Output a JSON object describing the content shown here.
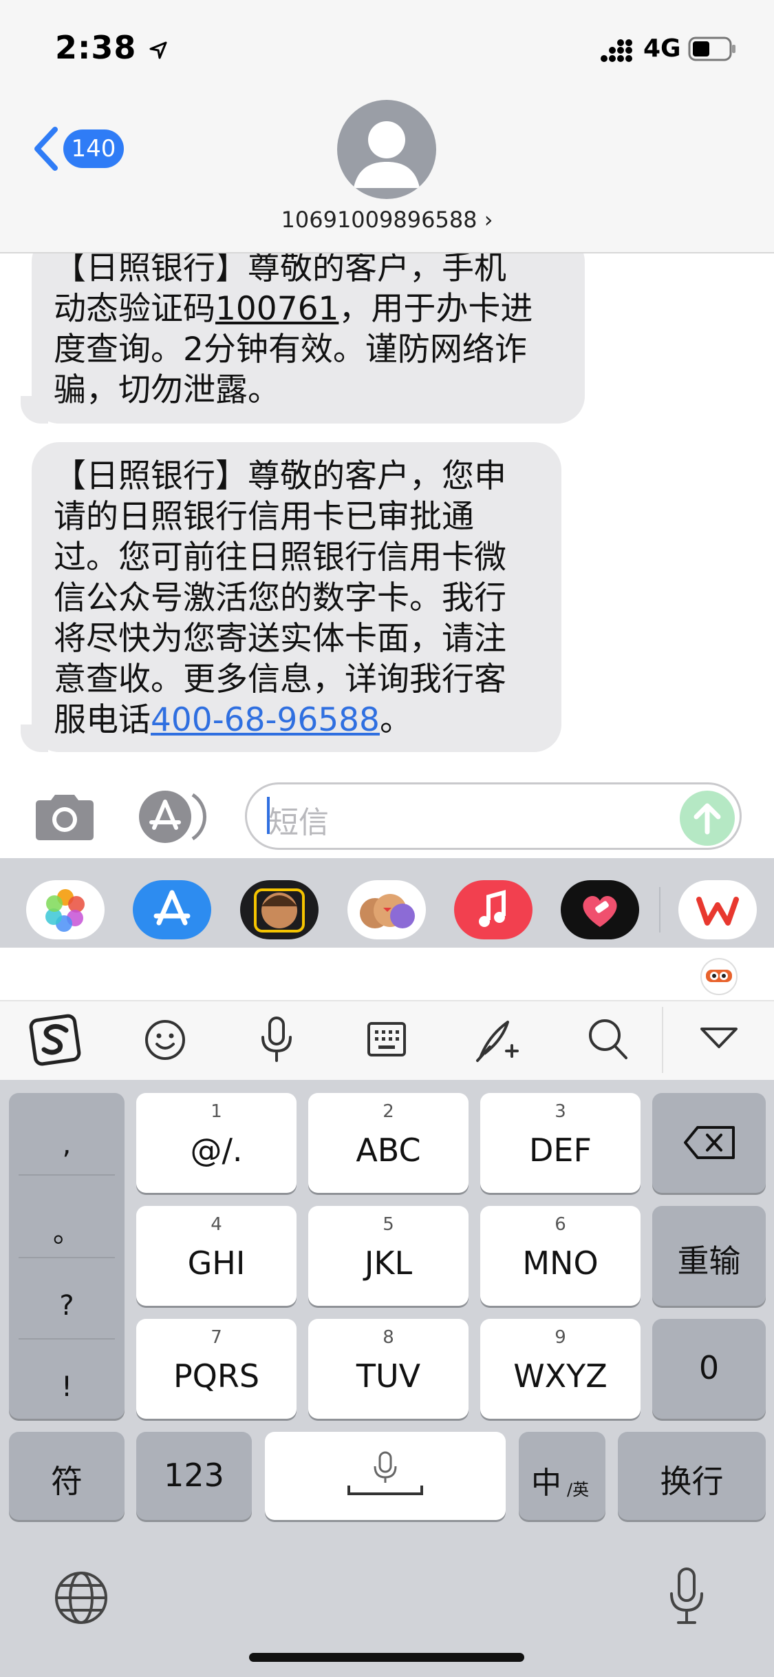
{
  "status": {
    "time": "2:38",
    "network": "4G"
  },
  "header": {
    "back_count": "140",
    "contact": "10691009896588 ›"
  },
  "messages": {
    "m1": {
      "line1": "【日照银行】尊敬的客户，手机",
      "line2_pre": "动态验证码",
      "code": "100761",
      "line2_post": "，用于办卡进",
      "line3": "度查询。2分钟有效。谨防网络诈",
      "line4": "骗，切勿泄露。"
    },
    "m2": {
      "line1": "【日照银行】尊敬的客户，您申",
      "line2": "请的日照银行信用卡已审批通",
      "line3": "过。您可前往日照银行信用卡微",
      "line4": "信公众号激活您的数字卡。我行",
      "line5": "将尽快为您寄送实体卡面，请注",
      "line6": "意查收。更多信息，详询我行客",
      "line7_pre": "服电话",
      "phone": "400-68-96588",
      "line7_post": "。"
    }
  },
  "input": {
    "placeholder": "短信"
  },
  "app_strip": [
    "photos-app",
    "app-store-app",
    "memoji-app",
    "animoji-app",
    "music-app",
    "heart-app",
    "wps-app"
  ],
  "keyboard": {
    "punct": [
      ",",
      "。",
      "?",
      "!"
    ],
    "keys": [
      {
        "num": "1",
        "label": "@/."
      },
      {
        "num": "2",
        "label": "ABC"
      },
      {
        "num": "3",
        "label": "DEF"
      },
      {
        "num": "4",
        "label": "GHI"
      },
      {
        "num": "5",
        "label": "JKL"
      },
      {
        "num": "6",
        "label": "MNO"
      },
      {
        "num": "7",
        "label": "PQRS"
      },
      {
        "num": "8",
        "label": "TUV"
      },
      {
        "num": "9",
        "label": "WXYZ"
      }
    ],
    "reinput": "重输",
    "zero": "0",
    "symbols": "符",
    "numbers": "123",
    "lang_zh": "中",
    "lang_en": "/英",
    "newline": "换行"
  },
  "colors": {
    "accent": "#2f7cf6",
    "bubble": "#e9e9eb",
    "link": "#2f6fe0",
    "keyboard_bg": "#d1d3d8"
  }
}
